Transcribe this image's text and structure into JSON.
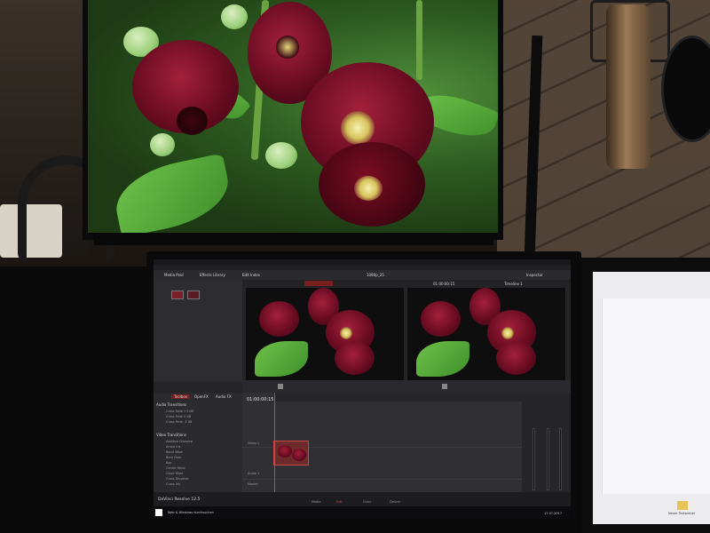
{
  "app": {
    "product_name": "DaVinci Resolve 12.5",
    "project_title": "1080p_25",
    "toolbar": {
      "media_pool": "Media Pool",
      "effects_library": "Effects Library",
      "edit_index": "Edit Index",
      "inspector": "Inspector"
    },
    "viewer_timecode": "01:00:00:15",
    "clip_label": "Timeline 1",
    "effects": {
      "tabs": [
        "Toolbox",
        "OpenFX",
        "Audio FX"
      ],
      "audio_transitions_header": "Audio Transitions",
      "audio_transitions": [
        "Cross Fade +3 dB",
        "Cross Fade 0 dB",
        "Cross Fade -3 dB"
      ],
      "video_transitions_header": "Video Transitions",
      "video_transitions": [
        "Additive Dissolve",
        "Arrow Iris",
        "Band Wipe",
        "Barn Door",
        "Box",
        "Center Wipe",
        "Clock Wipe",
        "Cross Dissolve",
        "Cross Iris"
      ]
    },
    "tracks": {
      "video": "Video 1",
      "audio": "Audio 1",
      "master": "Master"
    },
    "pages": [
      "Media",
      "Edit",
      "Color",
      "Deliver"
    ],
    "active_page": "Edit",
    "taskbar": {
      "search_placeholder": "Web & Windows durchsuchen",
      "date": "17.07.2017"
    }
  },
  "right_monitor": {
    "folder_label": "Neuer Textordner"
  },
  "colors": {
    "resolve_bg": "#252528",
    "accent_red": "#e23b3b",
    "flower_red": "#8a1428",
    "leaf_green": "#5fae3a"
  }
}
